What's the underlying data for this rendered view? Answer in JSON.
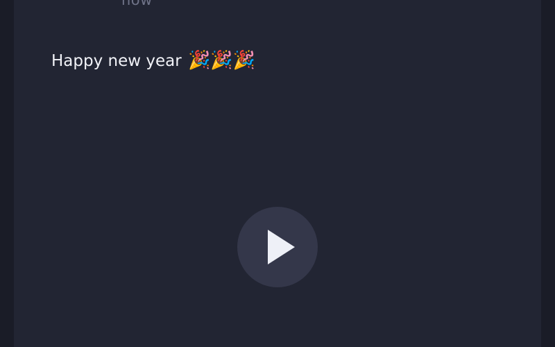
{
  "post": {
    "timestamp": "now",
    "text": "Happy new year",
    "emojis": "🎉🎉🎉"
  },
  "icons": {
    "avatar": "hexagon-avatar-icon",
    "play": "play-icon"
  },
  "colors": {
    "page_background": "#1a1c27",
    "card_background": "#222533",
    "avatar_border": "#e8669a",
    "play_button_background": "#34374a",
    "play_icon": "#eef0f7",
    "timestamp_text": "#6f7388",
    "post_text": "#f1f2f7"
  }
}
